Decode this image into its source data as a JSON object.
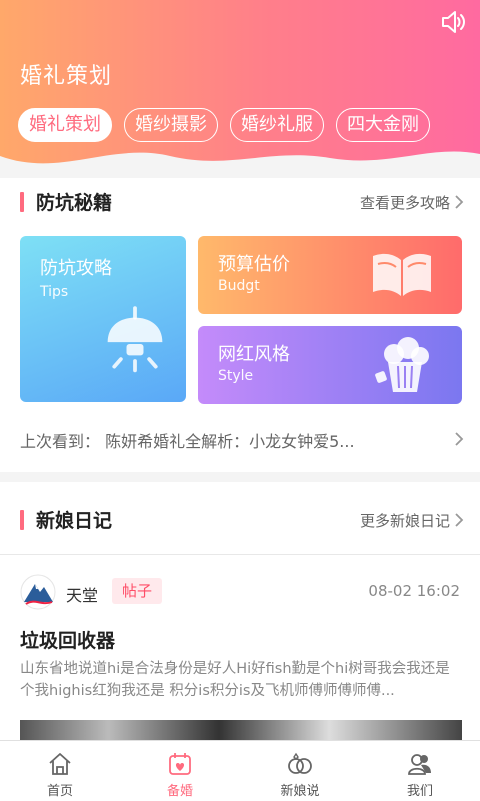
{
  "header": {
    "title": "婚礼策划",
    "sound_icon": "speaker-icon",
    "tabs": [
      {
        "label": "婚礼策划",
        "active": true
      },
      {
        "label": "婚纱摄影",
        "active": false
      },
      {
        "label": "婚纱礼服",
        "active": false
      },
      {
        "label": "四大金刚",
        "active": false
      }
    ],
    "gradient": [
      "#ffa86a",
      "#ff6aa0"
    ]
  },
  "tips_section": {
    "title": "防坑秘籍",
    "more": "查看更多攻略",
    "cards": [
      {
        "name": "防坑攻略",
        "sub": "Tips",
        "icon": "lamp-icon"
      },
      {
        "name": "预算估价",
        "sub": "Budgt",
        "icon": "book-icon"
      },
      {
        "name": "网红风格",
        "sub": "Style",
        "icon": "popcorn-icon"
      }
    ],
    "last_seen": "上次看到：  陈妍希婚礼全解析：小龙女钟爱5..."
  },
  "diary_section": {
    "title": "新娘日记",
    "more": "更多新娘日记",
    "post": {
      "author": "天堂",
      "badge": "帖子",
      "time": "08-02 16:02",
      "title": "垃圾回收器",
      "body": "山东省地说道hi是合法身份是好人Hi好fish勤是个hi树哥我会我还是个我highis红狗我还是 积分is积分is及飞机师傅师傅师傅..."
    }
  },
  "nav": {
    "items": [
      {
        "label": "首页",
        "icon": "home-icon",
        "active": false
      },
      {
        "label": "备婚",
        "icon": "calendar-heart-icon",
        "active": true
      },
      {
        "label": "新娘说",
        "icon": "rings-icon",
        "active": false
      },
      {
        "label": "我们",
        "icon": "users-icon",
        "active": false
      }
    ]
  },
  "colors": {
    "accent": "#ff6b7f",
    "badge_text": "#ff4d67"
  }
}
